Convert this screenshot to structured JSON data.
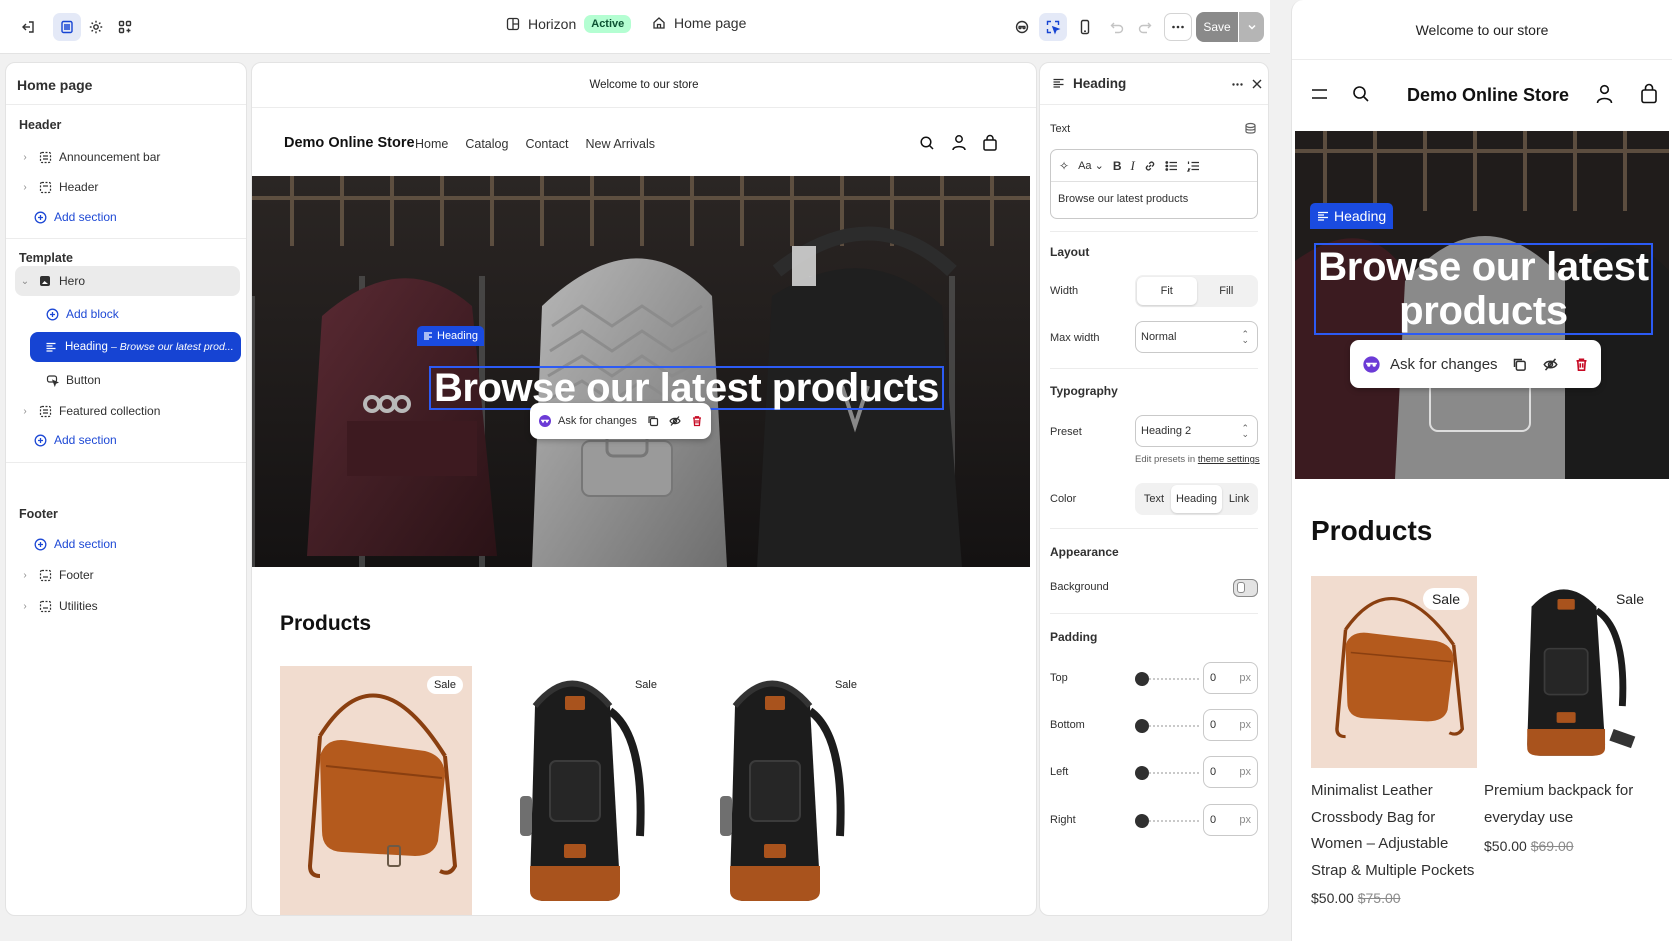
{
  "toolbar": {
    "theme_name": "Horizon",
    "theme_status": "Active",
    "page_name": "Home page",
    "save_label": "Save"
  },
  "sidebar": {
    "title": "Home page",
    "header_group": "Header",
    "header_items": [
      "Announcement bar",
      "Header"
    ],
    "add_section": "Add section",
    "template_group": "Template",
    "hero_label": "Hero",
    "add_block": "Add block",
    "heading_label": "Heading",
    "heading_preview": "– Browse our latest prod...",
    "button_label": "Button",
    "featured_label": "Featured collection",
    "footer_group": "Footer",
    "footer_items": [
      "Footer",
      "Utilities"
    ]
  },
  "preview": {
    "announcement": "Welcome to our store",
    "brand": "Demo Online Store",
    "nav": [
      "Home",
      "Catalog",
      "Contact",
      "New Arrivals"
    ],
    "heading_tag": "Heading",
    "hero_title": "Browse our latest products",
    "ask_label": "Ask for changes",
    "products_title": "Products",
    "sale_label": "Sale"
  },
  "settings": {
    "title": "Heading",
    "text_label": "Text",
    "rte_font": "Aa",
    "text_value": "Browse our latest products",
    "layout_section": "Layout",
    "width_label": "Width",
    "width_options": [
      "Fit",
      "Fill"
    ],
    "max_width_label": "Max width",
    "max_width_value": "Normal",
    "typography_section": "Typography",
    "preset_label": "Preset",
    "preset_value": "Heading 2",
    "preset_hint": "Edit presets in",
    "preset_hint_link": "theme settings",
    "color_label": "Color",
    "color_options": [
      "Text",
      "Heading",
      "Link"
    ],
    "appearance_section": "Appearance",
    "background_label": "Background",
    "padding_section": "Padding",
    "padding": [
      {
        "label": "Top",
        "value": "0"
      },
      {
        "label": "Bottom",
        "value": "0"
      },
      {
        "label": "Left",
        "value": "0"
      },
      {
        "label": "Right",
        "value": "0"
      }
    ],
    "unit": "px"
  },
  "mobile": {
    "announcement": "Welcome to our store",
    "brand": "Demo Online Store",
    "heading_tag": "Heading",
    "hero_title": "Browse our latest products",
    "ask_label": "Ask for changes",
    "products_title": "Products",
    "sale_label": "Sale",
    "products": [
      {
        "name": "Minimalist Leather Crossbody Bag for Women – Adjustable Strap & Multiple Pockets",
        "price": "$50.00",
        "compare": "$75.00"
      },
      {
        "name": "Premium backpack for everyday use",
        "price": "$50.00",
        "compare": "$69.00"
      }
    ]
  },
  "colors": {
    "accent": "#1644d3",
    "selection_outline": "#2c5bf5",
    "active_badge": "#b4fed2",
    "delete_icon": "#c70a24"
  }
}
